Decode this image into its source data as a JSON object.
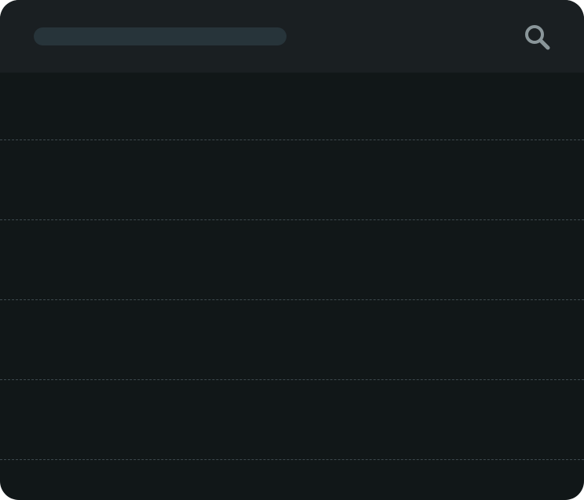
{
  "search": {
    "placeholder": "",
    "icon": "search-icon"
  },
  "list": {
    "rows": [
      "",
      "",
      "",
      "",
      "",
      ""
    ]
  },
  "colors": {
    "background": "#111718",
    "header": "#1a1f22",
    "search_bar": "#27343a",
    "divider": "#3e4a4e",
    "icon": "#8a969a"
  }
}
